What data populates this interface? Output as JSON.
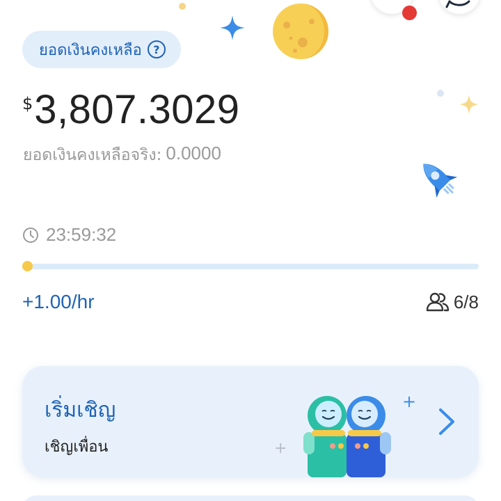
{
  "balance": {
    "chip_label": "ยอดเงินคงเหลือ",
    "help_icon": "?",
    "currency": "$",
    "amount": "3,807.3029",
    "real_label": "ยอดเงินคงเหลือจริง:",
    "real_value": "0.0000"
  },
  "timer": {
    "icon": "clock-icon",
    "countdown": "23:59:32",
    "progress_fraction": 0.01
  },
  "stats": {
    "rate": "+1.00/hr",
    "members_icon": "people-icon",
    "members": "6/8"
  },
  "invite_card": {
    "title": "เริ่มเชิญ",
    "subtitle": "เชิญเพื่อน",
    "arrow_icon": "chevron-right-icon"
  },
  "colors": {
    "accent": "#1e63b5",
    "progress": "#f7c948",
    "track": "#dcebf8",
    "card": "#e8f1fb",
    "muted": "#9a9a9a"
  }
}
